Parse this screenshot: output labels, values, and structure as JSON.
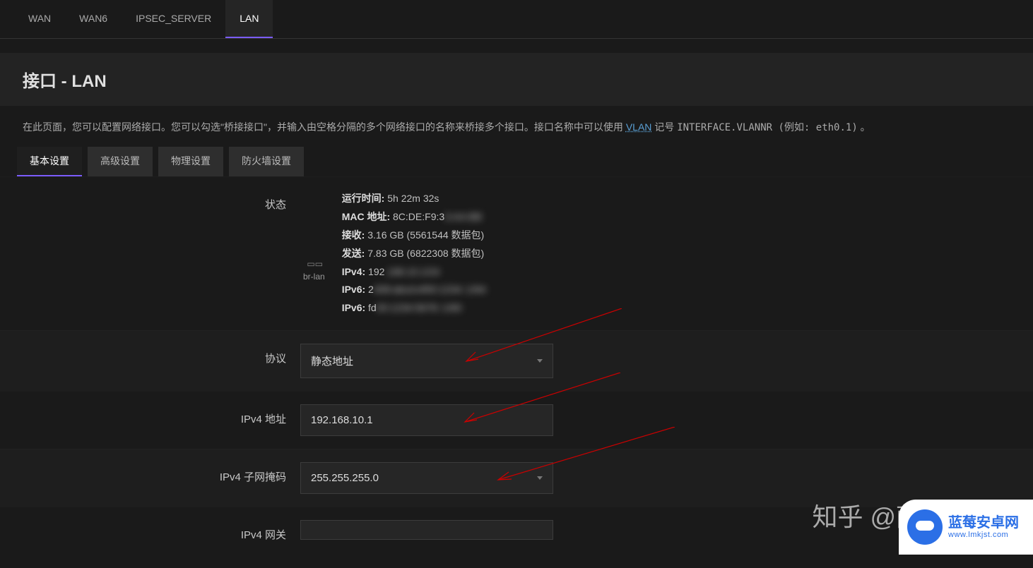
{
  "top_tabs": {
    "wan": "WAN",
    "wan6": "WAN6",
    "ipsec": "IPSEC_SERVER",
    "lan": "LAN"
  },
  "header": {
    "title": "接口 - LAN"
  },
  "desc": {
    "part1": "在此页面，您可以配置网络接口。您可以勾选\"桥接接口\"，并输入由空格分隔的多个网络接口的名称来桥接多个接口。接口名称中可以使用 ",
    "vlan_link": "VLAN",
    "part2": " 记号 ",
    "mono": "INTERFACE.VLANNR (例如: eth0.1)",
    "part3": " 。"
  },
  "sub_tabs": {
    "basic": "基本设置",
    "advanced": "高级设置",
    "physical": "物理设置",
    "firewall": "防火墙设置"
  },
  "labels": {
    "status": "状态",
    "protocol": "协议",
    "ipv4addr": "IPv4 地址",
    "ipv4mask": "IPv4 子网掩码",
    "ipv4gw": "IPv4 网关"
  },
  "iface": {
    "name": "br-lan"
  },
  "status": {
    "uptime_label": "运行时间:",
    "uptime_value": "5h 22m 32s",
    "mac_label": "MAC 地址:",
    "mac_value_prefix": "8C:DE:F9:3",
    "mac_value_blur": "3:AA:BB",
    "rx_label": "接收:",
    "rx_value": "3.16 GB (5561544 数据包)",
    "tx_label": "发送:",
    "tx_value": "7.83 GB (6822308 数据包)",
    "ipv4_label": "IPv4:",
    "ipv4_prefix": "192",
    "ipv4_blur": ".168.10.1/24",
    "ipv6a_label": "IPv6:",
    "ipv6a_prefix": "2",
    "ipv6a_blur": "408:abcd:ef00:1234::1/64",
    "ipv6b_label": "IPv6:",
    "ipv6b_prefix": "fd",
    "ipv6b_blur": "00:1234:5678::1/60"
  },
  "form": {
    "protocol_value": "静态地址",
    "ipv4addr_value": "192.168.10.1",
    "ipv4mask_value": "255.255.255.0",
    "ipv4gw_value": ""
  },
  "watermark": "知乎 @萨拉曼卡",
  "badge": {
    "cn": "蓝莓安卓网",
    "en": "www.lmkjst.com"
  }
}
